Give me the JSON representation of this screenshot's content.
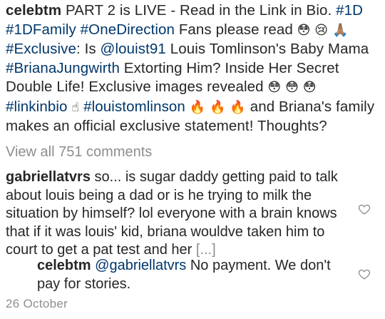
{
  "post": {
    "username": "celebtm",
    "caption_parts": {
      "p1": "PART 2 is LIVE - Read in the Link in Bio.",
      "h1": "#1D",
      "h2": "#1DFamily",
      "h3": "#OneDirection",
      "p2": "Fans please read",
      "e1": "😳 😢 🙏🏽",
      "h4": "#Exclusive",
      "p3": ": Is",
      "m1": "@louist91",
      "p4": "Louis Tomlinson's Baby Mama",
      "h5": "#BrianaJungwirth",
      "p5": "Extorting Him? Inside Her Secret Double Life! Exclusive images revealed",
      "e2": "😳 😳 😳",
      "h6": "#linkinbio",
      "e3": "☝",
      "h7": "#louistomlinson",
      "e4": "🔥 🔥 🔥",
      "p6": "and Briana's family makes an official exclusive statement! Thoughts?"
    },
    "view_all_comments": "View all 751 comments"
  },
  "comment": {
    "username": "gabriellatvrs",
    "text": "so... is sugar daddy getting paid to talk about louis being a dad or is he trying to milk the situation by himself? lol everyone with a brain knows that if it was louis' kid, briana wouldve taken him to court to get a pat test and her",
    "more": "[...]"
  },
  "reply": {
    "username": "celebtm",
    "mention": "@gabriellatvrs",
    "text": "No payment. We don't pay for stories."
  },
  "date": "26 October",
  "colors": {
    "text": "#262626",
    "link": "#00376b",
    "muted": "#8e8e8e"
  },
  "icons": {
    "comment_like": "heart-outline-icon",
    "reply_like": "heart-outline-icon"
  }
}
